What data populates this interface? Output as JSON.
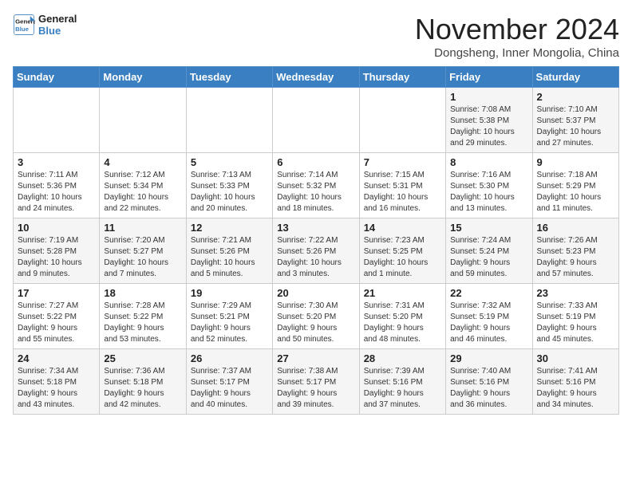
{
  "logo": {
    "line1": "General",
    "line2": "Blue"
  },
  "title": "November 2024",
  "location": "Dongsheng, Inner Mongolia, China",
  "weekdays": [
    "Sunday",
    "Monday",
    "Tuesday",
    "Wednesday",
    "Thursday",
    "Friday",
    "Saturday"
  ],
  "weeks": [
    [
      {
        "day": "",
        "info": ""
      },
      {
        "day": "",
        "info": ""
      },
      {
        "day": "",
        "info": ""
      },
      {
        "day": "",
        "info": ""
      },
      {
        "day": "",
        "info": ""
      },
      {
        "day": "1",
        "info": "Sunrise: 7:08 AM\nSunset: 5:38 PM\nDaylight: 10 hours\nand 29 minutes."
      },
      {
        "day": "2",
        "info": "Sunrise: 7:10 AM\nSunset: 5:37 PM\nDaylight: 10 hours\nand 27 minutes."
      }
    ],
    [
      {
        "day": "3",
        "info": "Sunrise: 7:11 AM\nSunset: 5:36 PM\nDaylight: 10 hours\nand 24 minutes."
      },
      {
        "day": "4",
        "info": "Sunrise: 7:12 AM\nSunset: 5:34 PM\nDaylight: 10 hours\nand 22 minutes."
      },
      {
        "day": "5",
        "info": "Sunrise: 7:13 AM\nSunset: 5:33 PM\nDaylight: 10 hours\nand 20 minutes."
      },
      {
        "day": "6",
        "info": "Sunrise: 7:14 AM\nSunset: 5:32 PM\nDaylight: 10 hours\nand 18 minutes."
      },
      {
        "day": "7",
        "info": "Sunrise: 7:15 AM\nSunset: 5:31 PM\nDaylight: 10 hours\nand 16 minutes."
      },
      {
        "day": "8",
        "info": "Sunrise: 7:16 AM\nSunset: 5:30 PM\nDaylight: 10 hours\nand 13 minutes."
      },
      {
        "day": "9",
        "info": "Sunrise: 7:18 AM\nSunset: 5:29 PM\nDaylight: 10 hours\nand 11 minutes."
      }
    ],
    [
      {
        "day": "10",
        "info": "Sunrise: 7:19 AM\nSunset: 5:28 PM\nDaylight: 10 hours\nand 9 minutes."
      },
      {
        "day": "11",
        "info": "Sunrise: 7:20 AM\nSunset: 5:27 PM\nDaylight: 10 hours\nand 7 minutes."
      },
      {
        "day": "12",
        "info": "Sunrise: 7:21 AM\nSunset: 5:26 PM\nDaylight: 10 hours\nand 5 minutes."
      },
      {
        "day": "13",
        "info": "Sunrise: 7:22 AM\nSunset: 5:26 PM\nDaylight: 10 hours\nand 3 minutes."
      },
      {
        "day": "14",
        "info": "Sunrise: 7:23 AM\nSunset: 5:25 PM\nDaylight: 10 hours\nand 1 minute."
      },
      {
        "day": "15",
        "info": "Sunrise: 7:24 AM\nSunset: 5:24 PM\nDaylight: 9 hours\nand 59 minutes."
      },
      {
        "day": "16",
        "info": "Sunrise: 7:26 AM\nSunset: 5:23 PM\nDaylight: 9 hours\nand 57 minutes."
      }
    ],
    [
      {
        "day": "17",
        "info": "Sunrise: 7:27 AM\nSunset: 5:22 PM\nDaylight: 9 hours\nand 55 minutes."
      },
      {
        "day": "18",
        "info": "Sunrise: 7:28 AM\nSunset: 5:22 PM\nDaylight: 9 hours\nand 53 minutes."
      },
      {
        "day": "19",
        "info": "Sunrise: 7:29 AM\nSunset: 5:21 PM\nDaylight: 9 hours\nand 52 minutes."
      },
      {
        "day": "20",
        "info": "Sunrise: 7:30 AM\nSunset: 5:20 PM\nDaylight: 9 hours\nand 50 minutes."
      },
      {
        "day": "21",
        "info": "Sunrise: 7:31 AM\nSunset: 5:20 PM\nDaylight: 9 hours\nand 48 minutes."
      },
      {
        "day": "22",
        "info": "Sunrise: 7:32 AM\nSunset: 5:19 PM\nDaylight: 9 hours\nand 46 minutes."
      },
      {
        "day": "23",
        "info": "Sunrise: 7:33 AM\nSunset: 5:19 PM\nDaylight: 9 hours\nand 45 minutes."
      }
    ],
    [
      {
        "day": "24",
        "info": "Sunrise: 7:34 AM\nSunset: 5:18 PM\nDaylight: 9 hours\nand 43 minutes."
      },
      {
        "day": "25",
        "info": "Sunrise: 7:36 AM\nSunset: 5:18 PM\nDaylight: 9 hours\nand 42 minutes."
      },
      {
        "day": "26",
        "info": "Sunrise: 7:37 AM\nSunset: 5:17 PM\nDaylight: 9 hours\nand 40 minutes."
      },
      {
        "day": "27",
        "info": "Sunrise: 7:38 AM\nSunset: 5:17 PM\nDaylight: 9 hours\nand 39 minutes."
      },
      {
        "day": "28",
        "info": "Sunrise: 7:39 AM\nSunset: 5:16 PM\nDaylight: 9 hours\nand 37 minutes."
      },
      {
        "day": "29",
        "info": "Sunrise: 7:40 AM\nSunset: 5:16 PM\nDaylight: 9 hours\nand 36 minutes."
      },
      {
        "day": "30",
        "info": "Sunrise: 7:41 AM\nSunset: 5:16 PM\nDaylight: 9 hours\nand 34 minutes."
      }
    ]
  ]
}
